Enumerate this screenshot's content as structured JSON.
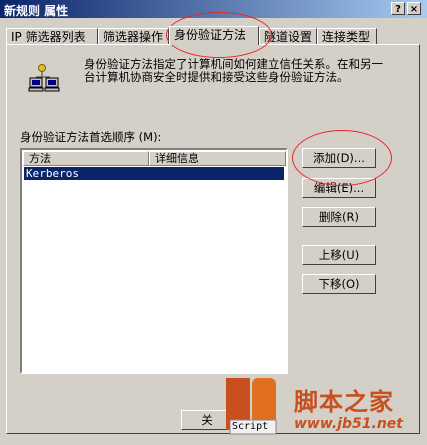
{
  "window": {
    "title": "新规则 属性",
    "help_glyph": "?",
    "close_glyph": "×"
  },
  "tabs": [
    {
      "label": "IP 筛选器列表"
    },
    {
      "label": "筛选器操作"
    },
    {
      "label": "身份验证方法"
    },
    {
      "label": "隧道设置"
    },
    {
      "label": "连接类型"
    }
  ],
  "auth": {
    "description": "身份验证方法指定了计算机间如何建立信任关系。在和另一台计算机协商安全时提供和接受这些身份验证方法。",
    "list_label": "身份验证方法首选顺序 (M):",
    "columns": [
      "方法",
      "详细信息"
    ],
    "rows": [
      {
        "method": "Kerberos",
        "details": ""
      }
    ]
  },
  "buttons": {
    "add": "添加(D)...",
    "edit": "编辑(E)...",
    "remove": "删除(R)",
    "move_up": "上移(U)",
    "move_down": "下移(O)",
    "close": "关"
  },
  "watermark": {
    "brand": "脚本之家",
    "url": "www.jb51.net",
    "logo_text": "JB",
    "logo_sub": "Script"
  },
  "colors": {
    "titlebar": "#0a246a",
    "highlight": "#0a246a",
    "annotation_ring": "#e8252b"
  }
}
